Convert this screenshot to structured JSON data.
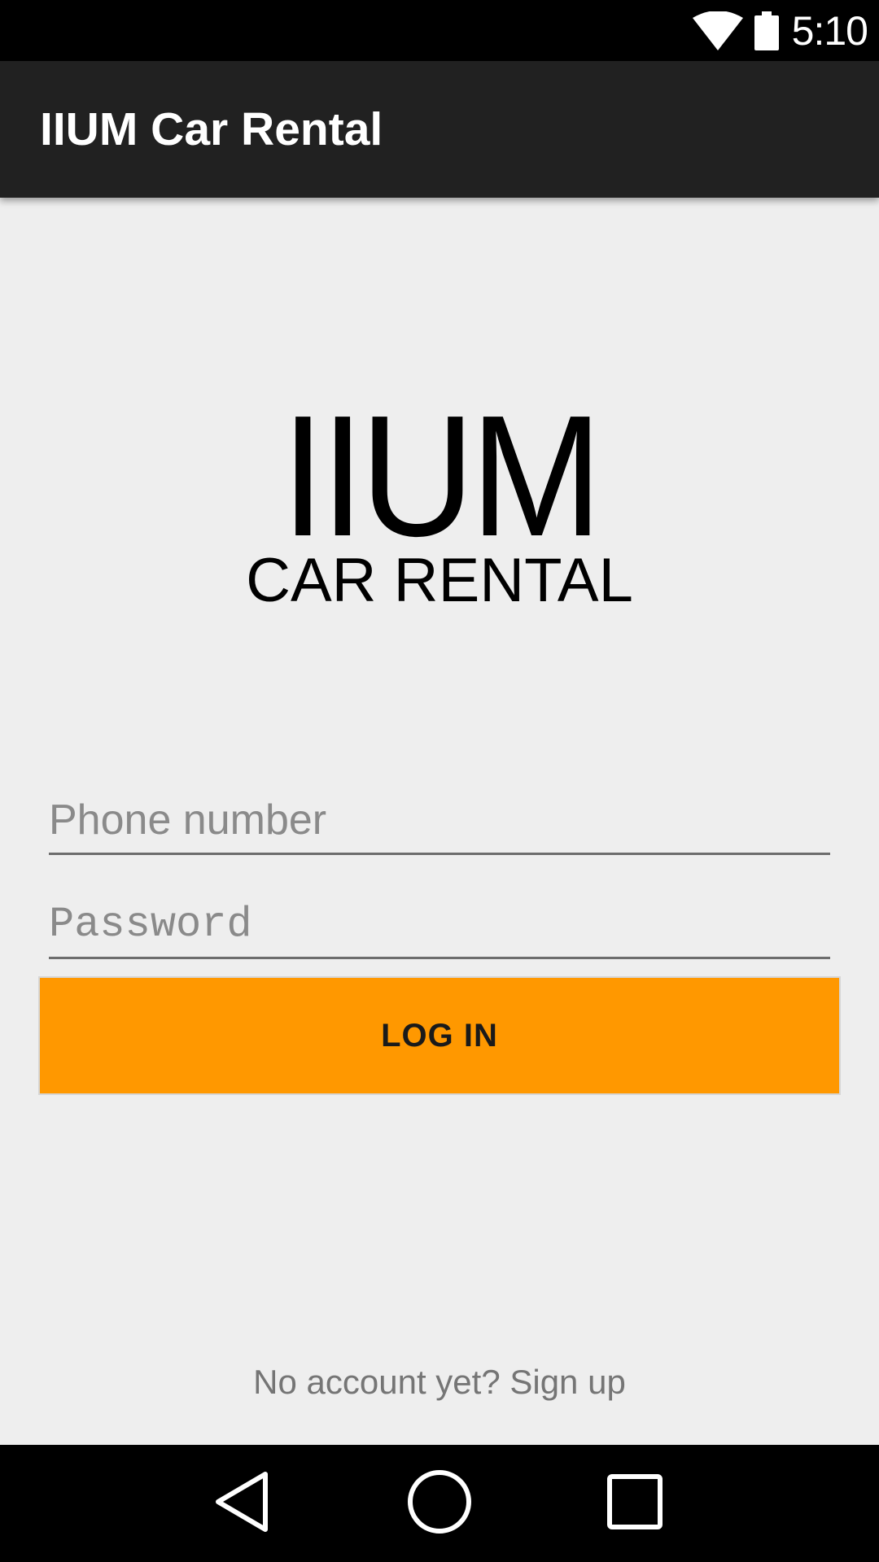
{
  "status_bar": {
    "time": "5:10",
    "icons": [
      "wifi-icon",
      "battery-icon"
    ]
  },
  "app_bar": {
    "title": "IIUM Car Rental"
  },
  "logo": {
    "main": "IIUM",
    "sub": "CAR RENTAL"
  },
  "form": {
    "phone_placeholder": "Phone number",
    "phone_value": "",
    "password_placeholder": "Password",
    "password_value": "",
    "login_label": "LOG IN"
  },
  "signup": {
    "text": "No account yet? Sign up"
  },
  "nav_bar": {
    "icons": [
      "back-icon",
      "home-icon",
      "recents-icon"
    ]
  },
  "colors": {
    "background": "#eeeeee",
    "app_bar": "#212121",
    "accent": "#ff9800",
    "status_bar": "#000000"
  }
}
